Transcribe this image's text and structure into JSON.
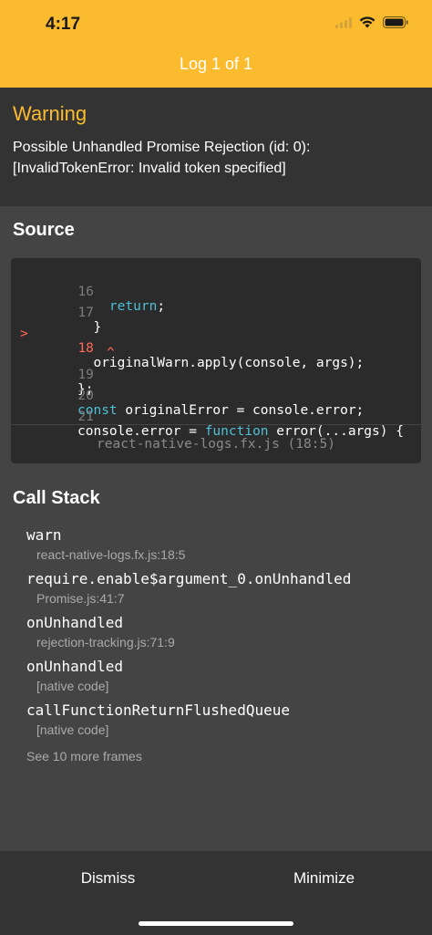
{
  "status_bar": {
    "time": "4:17"
  },
  "header": {
    "title": "Log 1 of 1"
  },
  "warning": {
    "title": "Warning",
    "message_line1": "Possible Unhandled Promise Rejection (id: 0):",
    "message_line2": "[InvalidTokenError: Invalid token specified]"
  },
  "source": {
    "title": "Source",
    "lines": [
      {
        "num": "16",
        "text": "    return;"
      },
      {
        "num": "17",
        "text": "  }"
      },
      {
        "num": "18",
        "marker": ">",
        "text": "  originalWarn.apply(console, args);"
      },
      {
        "caret": "^"
      },
      {
        "num": "19",
        "text": "};"
      },
      {
        "num": "20",
        "text": "const originalError = console.error;"
      },
      {
        "num": "21",
        "text": "console.error = function error(...args) {"
      }
    ],
    "file": "react-native-logs.fx.js (18:5)"
  },
  "call_stack": {
    "title": "Call Stack",
    "frames": [
      {
        "name": "warn",
        "location": "react-native-logs.fx.js:18:5"
      },
      {
        "name": "require.enable$argument_0.onUnhandled",
        "location": "Promise.js:41:7"
      },
      {
        "name": "onUnhandled",
        "location": "rejection-tracking.js:71:9"
      },
      {
        "name": "onUnhandled",
        "location": "[native code]"
      },
      {
        "name": "callFunctionReturnFlushedQueue",
        "location": "[native code]"
      }
    ],
    "more": "See 10 more frames"
  },
  "footer": {
    "dismiss": "Dismiss",
    "minimize": "Minimize"
  },
  "colors": {
    "accent": "#fbbb2f",
    "error": "#ff6a57",
    "keyword": "#4ec0d6"
  }
}
